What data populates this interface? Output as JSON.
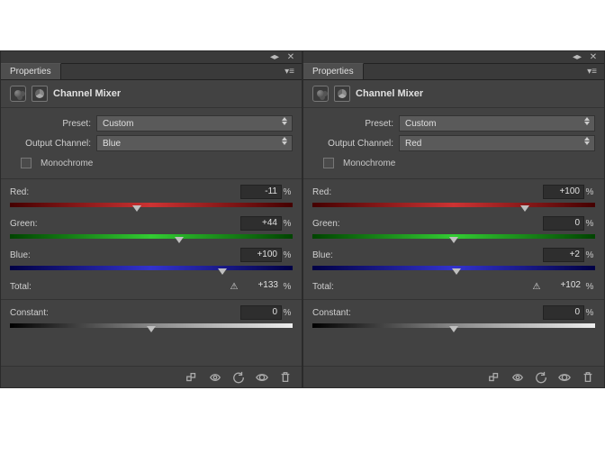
{
  "panels": [
    {
      "tab_label": "Properties",
      "title": "Channel Mixer",
      "preset_label": "Preset:",
      "preset_value": "Custom",
      "output_label": "Output Channel:",
      "output_value": "Blue",
      "monochrome_label": "Monochrome",
      "monochrome_checked": false,
      "sliders": {
        "red": {
          "label": "Red:",
          "value": "-11",
          "pos": 45,
          "gradient": "redmid"
        },
        "green": {
          "label": "Green:",
          "value": "+44",
          "pos": 60,
          "gradient": "greenmid"
        },
        "blue": {
          "label": "Blue:",
          "value": "+100",
          "pos": 75,
          "gradient": "bluemid"
        }
      },
      "total": {
        "label": "Total:",
        "value": "+133",
        "warn": true
      },
      "constant": {
        "label": "Constant:",
        "value": "0",
        "pos": 50,
        "gradient": "gray"
      },
      "pct": "%"
    },
    {
      "tab_label": "Properties",
      "title": "Channel Mixer",
      "preset_label": "Preset:",
      "preset_value": "Custom",
      "output_label": "Output Channel:",
      "output_value": "Red",
      "monochrome_label": "Monochrome",
      "monochrome_checked": false,
      "sliders": {
        "red": {
          "label": "Red:",
          "value": "+100",
          "pos": 75,
          "gradient": "redmid"
        },
        "green": {
          "label": "Green:",
          "value": "0",
          "pos": 50,
          "gradient": "greenmid"
        },
        "blue": {
          "label": "Blue:",
          "value": "+2",
          "pos": 51,
          "gradient": "bluemid"
        }
      },
      "total": {
        "label": "Total:",
        "value": "+102",
        "warn": true
      },
      "constant": {
        "label": "Constant:",
        "value": "0",
        "pos": 50,
        "gradient": "gray"
      },
      "pct": "%"
    }
  ]
}
